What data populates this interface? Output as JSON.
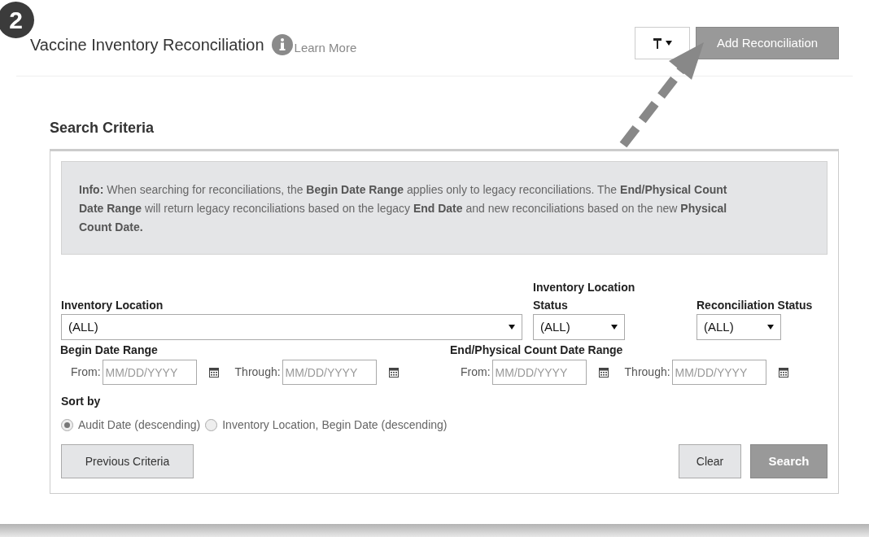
{
  "step_badge": "2",
  "header": {
    "title": "Vaccine Inventory Reconciliation",
    "learn_more": "Learn More",
    "add_button": "Add Reconciliation"
  },
  "search_criteria": {
    "heading": "Search Criteria",
    "info": "**Info:** When searching for reconciliations, the **Begin Date Range** applies only to legacy reconciliations. The **End/Physical Count Date Range** will return legacy reconciliations based on the legacy **End Date** and new reconciliations based on the new **Physical Count Date.**",
    "selects": [
      {
        "label": "Inventory Location",
        "value": "(ALL)"
      },
      {
        "label": "Inventory Location Status",
        "value": "(ALL)"
      },
      {
        "label": "Reconciliation Status",
        "value": "(ALL)"
      }
    ],
    "date_ranges": [
      {
        "label": "Begin Date Range",
        "from_label": "From:",
        "from_placeholder": "MM/DD/YYYY",
        "through_label": "Through:",
        "through_placeholder": "MM/DD/YYYY"
      },
      {
        "label": "End/Physical Count Date Range",
        "from_label": "From:",
        "from_placeholder": "MM/DD/YYYY",
        "through_label": "Through:",
        "through_placeholder": "MM/DD/YYYY"
      }
    ],
    "sort_by": {
      "label": "Sort by",
      "options": [
        {
          "label": "Audit Date (descending)",
          "selected": true
        },
        {
          "label": "Inventory Location, Begin Date (descending)",
          "selected": false
        }
      ]
    },
    "buttons": {
      "previous": "Previous Criteria",
      "clear": "Clear",
      "search": "Search"
    }
  }
}
